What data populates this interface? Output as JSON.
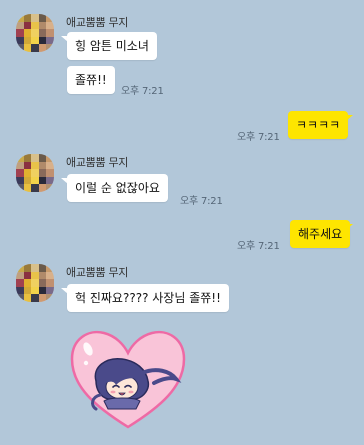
{
  "sender": {
    "name": "애교뿜뿜 무지",
    "avatar_colors": [
      "#c8a94a",
      "#9a7a3a",
      "#d8c08a",
      "#6a5a4a",
      "#c89a6a",
      "#c0a080",
      "#8a3040",
      "#e8c24a",
      "#b08a6a",
      "#d8b08a",
      "#a04050",
      "#e0b030",
      "#f0d060",
      "#8a6a5a",
      "#c09070",
      "#3a3a5a",
      "#d0a838",
      "#f3d24a",
      "#2a2a3a",
      "#7a6a8a",
      "#5a5a6a",
      "#e8c040",
      "#3a3a4a",
      "#d09a70",
      "#b09070"
    ]
  },
  "colors": {
    "background": "#b2c7d9",
    "incoming_bubble": "#ffffff",
    "outgoing_bubble": "#fee500",
    "heart_fill": "#f9c4d8",
    "heart_stroke": "#ee6aa5"
  },
  "messages": [
    {
      "id": "m1",
      "direction": "in",
      "text": "힝 암튼 미소녀",
      "time": ""
    },
    {
      "id": "m2",
      "direction": "in",
      "text": "졸쮸!!",
      "time": "오후 7:21"
    },
    {
      "id": "m3",
      "direction": "out",
      "text": "ㅋㅋㅋㅋ",
      "time": "오후 7:21"
    },
    {
      "id": "m4",
      "direction": "in",
      "text": "이럴 순 없잖아요",
      "time": "오후 7:21"
    },
    {
      "id": "m5",
      "direction": "out",
      "text": "해주세요",
      "time": "오후 7:21"
    },
    {
      "id": "m6",
      "direction": "in",
      "text": "헉 진짜요???? 사장님 졸쮸!!",
      "time": ""
    },
    {
      "id": "m7",
      "direction": "in",
      "type": "emoticon",
      "emoticon": "heart-character-emoticon"
    }
  ]
}
